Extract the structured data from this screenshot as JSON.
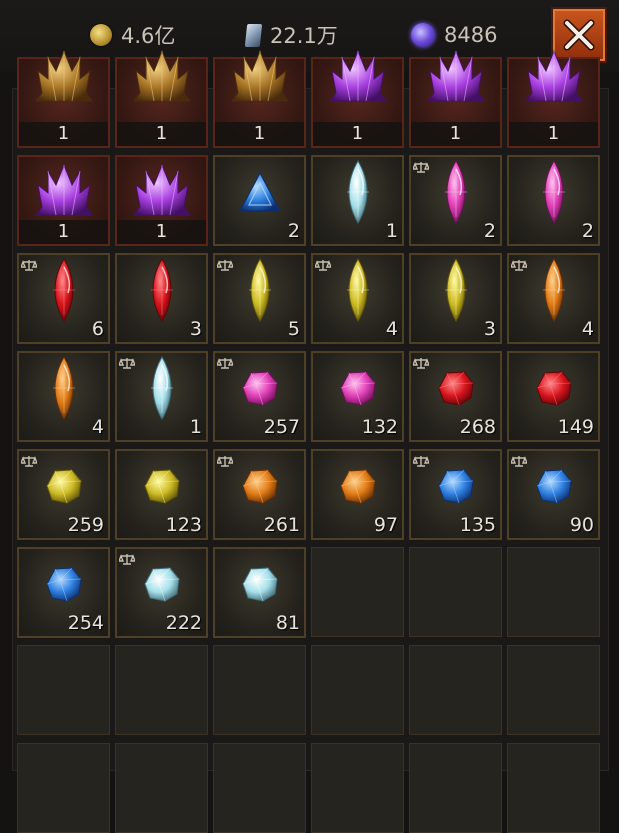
{
  "currencies": [
    {
      "icon": "gold-coin-icon",
      "value": "4.6亿"
    },
    {
      "icon": "shard-icon",
      "value": "22.1万"
    },
    {
      "icon": "purple-orb-icon",
      "value": "8486"
    }
  ],
  "close_label": "close",
  "colors": {
    "slot_border": "#4e4026",
    "slot_red_border": "#5a2418",
    "close_button": "#b2461a"
  },
  "slots": [
    {
      "gem": "amber-crystal",
      "type": "crystal",
      "quantity": "1",
      "marked": false,
      "red": true,
      "count_bar": true
    },
    {
      "gem": "amber-crystal",
      "type": "crystal",
      "quantity": "1",
      "marked": false,
      "red": true,
      "count_bar": true
    },
    {
      "gem": "amber-crystal",
      "type": "crystal",
      "quantity": "1",
      "marked": false,
      "red": true,
      "count_bar": true
    },
    {
      "gem": "purple-crystal",
      "type": "crystal",
      "quantity": "1",
      "marked": false,
      "red": true,
      "count_bar": true
    },
    {
      "gem": "purple-crystal",
      "type": "crystal",
      "quantity": "1",
      "marked": false,
      "red": true,
      "count_bar": true
    },
    {
      "gem": "purple-crystal",
      "type": "crystal",
      "quantity": "1",
      "marked": false,
      "red": true,
      "count_bar": true
    },
    {
      "gem": "purple-crystal",
      "type": "crystal",
      "quantity": "1",
      "marked": false,
      "red": true,
      "count_bar": true
    },
    {
      "gem": "purple-crystal",
      "type": "crystal",
      "quantity": "1",
      "marked": false,
      "red": true,
      "count_bar": true
    },
    {
      "gem": "blue-triangle",
      "type": "triangle",
      "quantity": "2",
      "marked": false,
      "red": false,
      "count_bar": false
    },
    {
      "gem": "ice-marquise",
      "type": "marquise",
      "quantity": "1",
      "marked": false,
      "red": false,
      "count_bar": false
    },
    {
      "gem": "pink-marquise",
      "type": "marquise",
      "quantity": "2",
      "marked": true,
      "red": false,
      "count_bar": false
    },
    {
      "gem": "pink-marquise",
      "type": "marquise",
      "quantity": "2",
      "marked": false,
      "red": false,
      "count_bar": false
    },
    {
      "gem": "red-marquise",
      "type": "marquise",
      "quantity": "6",
      "marked": true,
      "red": false,
      "count_bar": false
    },
    {
      "gem": "red-marquise",
      "type": "marquise",
      "quantity": "3",
      "marked": false,
      "red": false,
      "count_bar": false
    },
    {
      "gem": "yellow-marquise",
      "type": "marquise",
      "quantity": "5",
      "marked": true,
      "red": false,
      "count_bar": false
    },
    {
      "gem": "yellow-marquise",
      "type": "marquise",
      "quantity": "4",
      "marked": true,
      "red": false,
      "count_bar": false
    },
    {
      "gem": "yellow-marquise",
      "type": "marquise",
      "quantity": "3",
      "marked": false,
      "red": false,
      "count_bar": false
    },
    {
      "gem": "orange-marquise",
      "type": "marquise",
      "quantity": "4",
      "marked": true,
      "red": false,
      "count_bar": false
    },
    {
      "gem": "orange-marquise",
      "type": "marquise",
      "quantity": "4",
      "marked": false,
      "red": false,
      "count_bar": false
    },
    {
      "gem": "ice-marquise",
      "type": "marquise",
      "quantity": "1",
      "marked": true,
      "red": false,
      "count_bar": false
    },
    {
      "gem": "pink-rough",
      "type": "rough",
      "quantity": "257",
      "marked": true,
      "red": false,
      "count_bar": false
    },
    {
      "gem": "pink-rough",
      "type": "rough",
      "quantity": "132",
      "marked": false,
      "red": false,
      "count_bar": false
    },
    {
      "gem": "red-rough",
      "type": "rough",
      "quantity": "268",
      "marked": true,
      "red": false,
      "count_bar": false
    },
    {
      "gem": "red-rough",
      "type": "rough",
      "quantity": "149",
      "marked": false,
      "red": false,
      "count_bar": false
    },
    {
      "gem": "yellow-rough",
      "type": "rough",
      "quantity": "259",
      "marked": true,
      "red": false,
      "count_bar": false
    },
    {
      "gem": "yellow-rough",
      "type": "rough",
      "quantity": "123",
      "marked": false,
      "red": false,
      "count_bar": false
    },
    {
      "gem": "orange-rough",
      "type": "rough",
      "quantity": "261",
      "marked": true,
      "red": false,
      "count_bar": false
    },
    {
      "gem": "orange-rough",
      "type": "rough",
      "quantity": "97",
      "marked": false,
      "red": false,
      "count_bar": false
    },
    {
      "gem": "blue-rough",
      "type": "rough",
      "quantity": "135",
      "marked": true,
      "red": false,
      "count_bar": false
    },
    {
      "gem": "blue-rough",
      "type": "rough",
      "quantity": "90",
      "marked": true,
      "red": false,
      "count_bar": false
    },
    {
      "gem": "blue-rough",
      "type": "rough",
      "quantity": "254",
      "marked": false,
      "red": false,
      "count_bar": false
    },
    {
      "gem": "ice-rough",
      "type": "rough",
      "quantity": "222",
      "marked": true,
      "red": false,
      "count_bar": false
    },
    {
      "gem": "ice-rough",
      "type": "rough",
      "quantity": "81",
      "marked": false,
      "red": false,
      "count_bar": false
    }
  ]
}
